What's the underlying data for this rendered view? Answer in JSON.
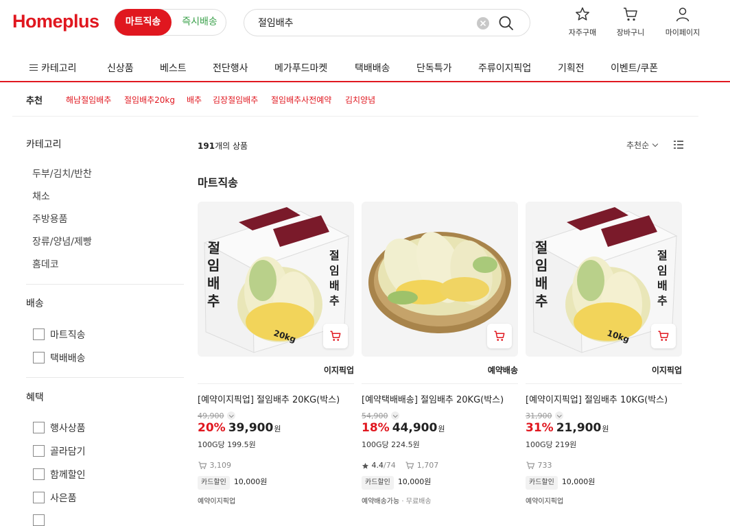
{
  "header": {
    "logo": "Homeplus",
    "mode_active": "마트직송",
    "mode_other": "즉시배송",
    "search_value": "절임배추",
    "icons": [
      {
        "name": "star-icon",
        "label": "자주구매"
      },
      {
        "name": "cart-icon",
        "label": "장바구니"
      },
      {
        "name": "user-icon",
        "label": "마이페이지"
      }
    ]
  },
  "nav": {
    "category": "카테고리",
    "items": [
      "신상품",
      "베스트",
      "전단행사",
      "메가푸드마켓",
      "택배배송",
      "단독특가",
      "주류이지픽업",
      "기획전",
      "이벤트/쿠폰"
    ]
  },
  "recommend": {
    "title": "추천",
    "keywords": [
      "해남절임배추",
      "절임배추20kg",
      "배추",
      "김장절임배추",
      "절임배추사전예약",
      "김치양념"
    ]
  },
  "sidebar": {
    "category_title": "카테고리",
    "categories": [
      "두부/김치/반찬",
      "채소",
      "주방용품",
      "장류/양념/제빵",
      "홈데코"
    ],
    "delivery_title": "배송",
    "delivery_options": [
      "마트직송",
      "택배배송"
    ],
    "benefit_title": "혜택",
    "benefit_options": [
      "행사상품",
      "골라담기",
      "함께할인",
      "사은품"
    ]
  },
  "results": {
    "count_num": "191",
    "count_suffix": "개의 상품",
    "sort_label": "추천순",
    "section_title": "마트직송"
  },
  "products": [
    {
      "tag": "이지픽업",
      "name": "[예약이지픽업] 절임배추 20KG(박스)",
      "orig_price": "49,900",
      "rate": "20%",
      "price": "39,900",
      "won": "원",
      "unit_price": "100G당 199.5원",
      "rating": "",
      "reviews": "",
      "buys": "3,109",
      "coupon_label": "카드할인",
      "coupon_amount": "10,000원",
      "note": "예약이지픽업",
      "note_sub": "",
      "box_label": "20kg"
    },
    {
      "tag": "예약배송",
      "name": "[예약택배배송] 절임배추 20KG(박스)",
      "orig_price": "54,900",
      "rate": "18%",
      "price": "44,900",
      "won": "원",
      "unit_price": "100G당 224.5원",
      "rating": "4.4",
      "reviews": "/74",
      "buys": "1,707",
      "coupon_label": "카드할인",
      "coupon_amount": "10,000원",
      "note": "예약배송가능",
      "note_sub": " · 무료배송",
      "box_label": ""
    },
    {
      "tag": "이지픽업",
      "name": "[예약이지픽업] 절임배추 10KG(박스)",
      "orig_price": "31,900",
      "rate": "31%",
      "price": "21,900",
      "won": "원",
      "unit_price": "100G당 219원",
      "rating": "",
      "reviews": "",
      "buys": "733",
      "coupon_label": "카드할인",
      "coupon_amount": "10,000원",
      "note": "예약이지픽업",
      "note_sub": "",
      "box_label": "10kg"
    }
  ],
  "colors": {
    "brand_red": "#e0171f",
    "express_green": "#3aa04a"
  }
}
